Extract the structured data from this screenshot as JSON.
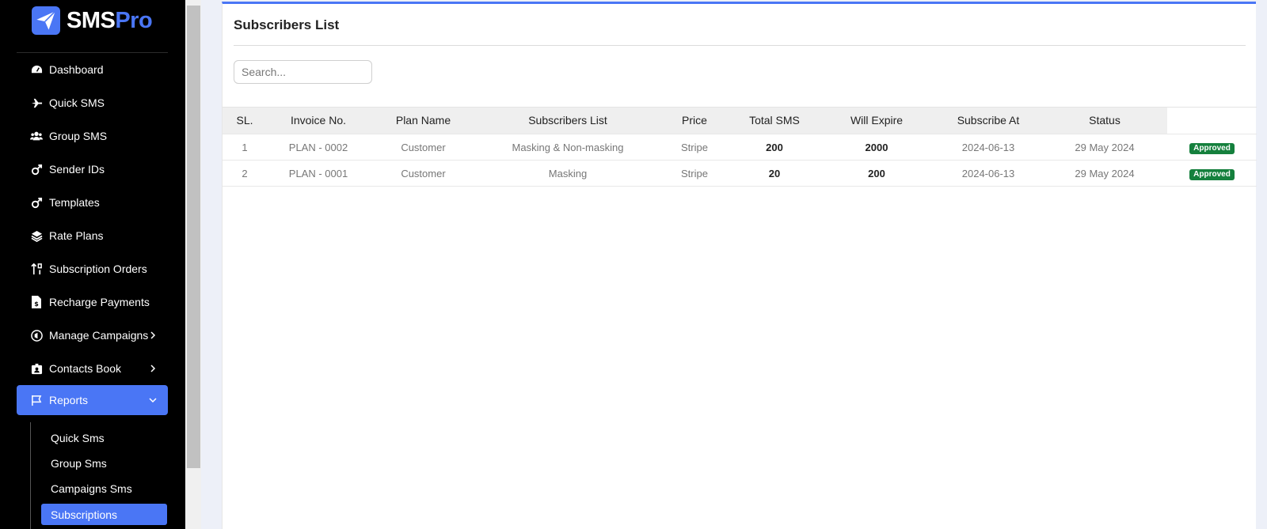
{
  "app": {
    "logo_part1": "SMS",
    "logo_part2": "Pro",
    "accent_color": "#4a76f5"
  },
  "sidebar": {
    "items": [
      {
        "label": "Dashboard",
        "icon": "gauge-icon"
      },
      {
        "label": "Quick SMS",
        "icon": "plane-icon"
      },
      {
        "label": "Group SMS",
        "icon": "users-icon"
      },
      {
        "label": "Sender IDs",
        "icon": "mars-icon"
      },
      {
        "label": "Templates",
        "icon": "mars-icon"
      },
      {
        "label": "Rate Plans",
        "icon": "layers-icon"
      },
      {
        "label": "Subscription Orders",
        "icon": "sort-icon"
      },
      {
        "label": "Recharge Payments",
        "icon": "invoice-dollar-icon"
      },
      {
        "label": "Manage Campaigns",
        "icon": "bullhorn-circle-icon",
        "has_children": true
      },
      {
        "label": "Contacts Book",
        "icon": "id-badge-icon",
        "has_children": true
      },
      {
        "label": "Reports",
        "icon": "flag-icon",
        "has_children": true,
        "expanded": true,
        "active": true
      }
    ],
    "report_subitems": [
      {
        "label": "Quick Sms"
      },
      {
        "label": "Group Sms"
      },
      {
        "label": "Campaigns Sms"
      },
      {
        "label": "Subscriptions",
        "active": true
      }
    ]
  },
  "main": {
    "title": "Subscribers List",
    "search_placeholder": "Search...",
    "table": {
      "headers": [
        "SL.",
        "Invoice No.",
        "Plan Name",
        "Subscribers List",
        "Price",
        "Total SMS",
        "Will Expire",
        "Subscribe At",
        "Status"
      ],
      "rows": [
        {
          "sl": "1",
          "invoice": "PLAN - 0002",
          "plan": "Customer",
          "list": "Masking & Non-masking",
          "price": "Stripe",
          "total_sms": "200",
          "will_expire": "2000",
          "subscribe_at": "2024-06-13",
          "status_date": "29 May 2024",
          "badge": "Approved"
        },
        {
          "sl": "2",
          "invoice": "PLAN - 0001",
          "plan": "Customer",
          "list": "Masking",
          "price": "Stripe",
          "total_sms": "20",
          "will_expire": "200",
          "subscribe_at": "2024-06-13",
          "status_date": "29 May 2024",
          "badge": "Approved"
        }
      ],
      "badge_color": "#15803d"
    }
  }
}
